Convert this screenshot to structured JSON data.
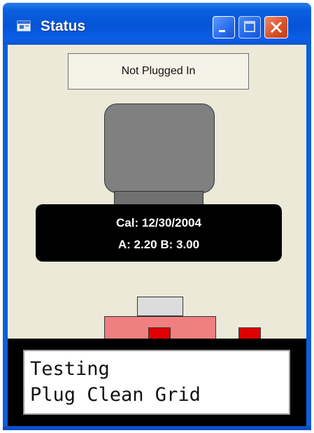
{
  "window": {
    "title": "Status",
    "title_icon": "app-window-icon",
    "buttons": {
      "minimize": "minimize-icon",
      "maximize": "maximize-icon",
      "close": "close-icon"
    }
  },
  "status": {
    "text": "Not Plugged In"
  },
  "calibration": {
    "line1": "Cal: 12/30/2004",
    "line2": "A: 2.20 B: 3.00"
  },
  "lcd": {
    "line1": "Testing",
    "line2": "Plug Clean Grid"
  },
  "colors": {
    "titlebar": "#0554d6",
    "client_background": "#ece9d8",
    "sensor_head": "#808080",
    "plug_body": "#f08080",
    "plug_pins": "#e00000",
    "lcd_background": "#ffffff"
  }
}
